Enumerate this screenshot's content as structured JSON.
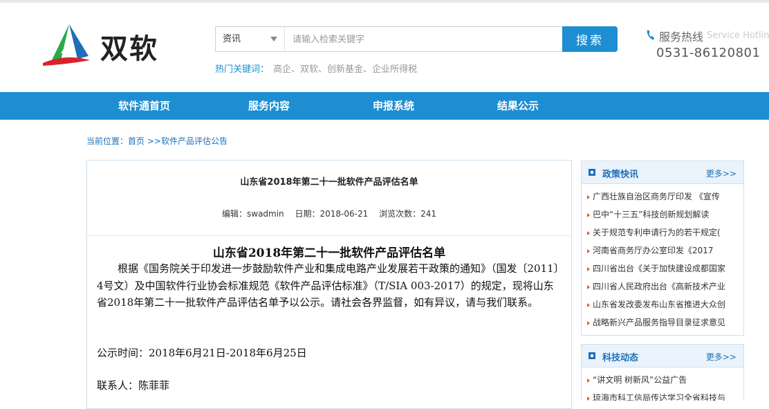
{
  "brand": {
    "name": "双软"
  },
  "search": {
    "category": "资讯",
    "placeholder": "请输入检索关键字",
    "button": "搜索"
  },
  "hotwords": {
    "label": "热门关键词：",
    "words": [
      "高企、",
      "双软、",
      "创新基金、",
      "企业所得税"
    ]
  },
  "hotline": {
    "label": "服务热线",
    "label_en": "Service Hotline",
    "number": "0531-86120801"
  },
  "nav": [
    "软件通首页",
    "服务内容",
    "申报系统",
    "结果公示"
  ],
  "breadcrumb": {
    "prefix": "当前位置：",
    "home": "首页",
    "sep": " >>",
    "current": "软件产品评估公告"
  },
  "article": {
    "title": "山东省2018年第二十一批软件产品评估名单",
    "editor": "编辑：swadmin",
    "date": "日期：2018-06-21",
    "views": "浏览次数：241",
    "body_title": "山东省2018年第二十一批软件产品评估名单",
    "paragraph": "根据《国务院关于印发进一步鼓励软件产业和集成电路产业发展若干政策的通知》（国发〔2011〕4号文）及中国软件行业协会标准规范《软件产品评估标准》（T/SIA 003-2017）的规定，现将山东省2018年第二十一批软件产品评估名单予以公示。请社会各界监督，如有异议，请与我们联系。",
    "pub_time": "公示时间：2018年6月21日-2018年6月25日",
    "contact": "联系人：陈菲菲"
  },
  "sidebar": {
    "policy": {
      "title": "政策快讯",
      "more": "更多>>",
      "items": [
        "广西壮族自治区商务厅印发 《宣传",
        "巴中“十三五”科技创新规划解读",
        "关于规范专利申请行为的若干规定(",
        "河南省商务厅办公室印发《2017",
        "四川省出台《关于加快建设成都国家",
        "四川省人民政府出台《高新技术产业",
        "山东省发改委发布山东省推进大众创",
        "战略新兴产品服务指导目录征求意见"
      ]
    },
    "tech": {
      "title": "科技动态",
      "more": "更多>>",
      "items": [
        "“讲文明 树新风”公益广告",
        "琼海市科工信局传达学习全省科技与"
      ]
    }
  },
  "colors": {
    "accent": "#1e8ed2",
    "link": "#1e6fb8",
    "logo_red": "#d9232a",
    "logo_green": "#2aa84a",
    "logo_blue": "#1e6fb8"
  }
}
